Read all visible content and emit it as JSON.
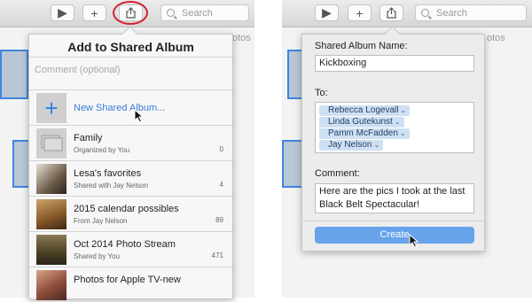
{
  "left_window": {
    "toolbar": {
      "search_placeholder": "Search"
    },
    "tab_fragment": "otos",
    "popover": {
      "title": "Add to Shared Album",
      "comment_placeholder": "Comment (optional)",
      "new_album_label": "New Shared Album...",
      "albums": [
        {
          "name": "Family",
          "subtitle": "Organized by You",
          "count": "0"
        },
        {
          "name": "Lesa's favorites",
          "subtitle": "Shared with Jay Nelson",
          "count": "4"
        },
        {
          "name": "2015 calendar possibles",
          "subtitle": "From Jay Nelson",
          "count": "89"
        },
        {
          "name": "Oct 2014 Photo Stream",
          "subtitle": "Shared by You",
          "count": "471"
        },
        {
          "name": "Photos for Apple TV-new",
          "subtitle": "",
          "count": ""
        }
      ]
    }
  },
  "right_window": {
    "toolbar": {
      "search_placeholder": "Search"
    },
    "tab_fragment": "otos",
    "popover": {
      "album_name_label": "Shared Album Name:",
      "album_name_value": "Kickboxing",
      "to_label": "To:",
      "recipients": [
        "Rebecca Logevall",
        "Linda Gutekunst",
        "Pamm McFadden",
        "Jay Nelson"
      ],
      "comment_label": "Comment:",
      "comment_value": "Here are the pics I took at the last Black Belt Spectacular!",
      "create_label": "Create"
    }
  },
  "colors": {
    "accent": "#3b7ed8",
    "highlight_circle": "#d2222f",
    "create_button": "#66a3ea"
  }
}
